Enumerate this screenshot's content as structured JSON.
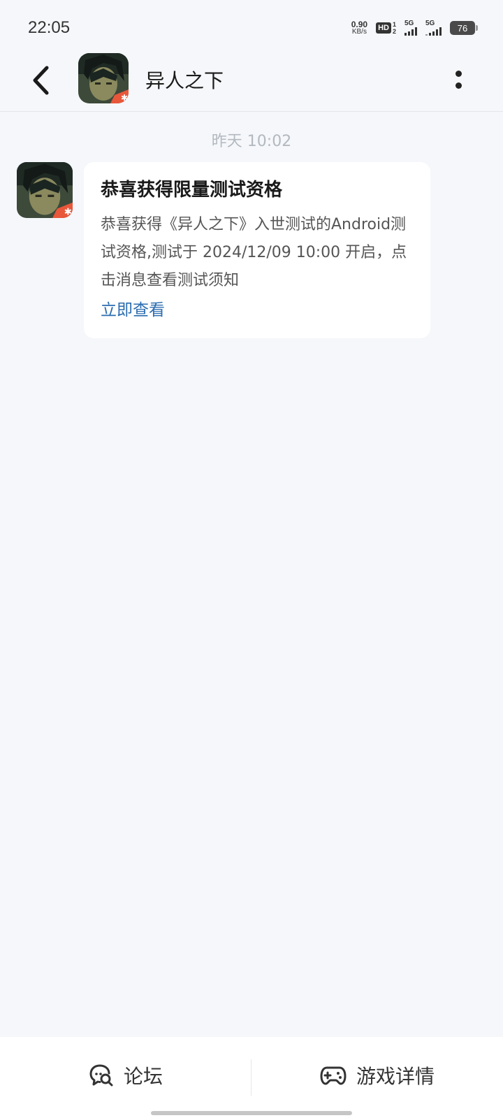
{
  "status_bar": {
    "time": "22:05",
    "net_speed_value": "0.90",
    "net_speed_unit": "KB/s",
    "hd_label": "HD",
    "hd_sim_top": "1",
    "hd_sim_bottom": "2",
    "signal1_label": "5G",
    "signal2_label": "5G",
    "battery_level": "76"
  },
  "header": {
    "title": "异人之下",
    "back_icon": "chevron-left-icon",
    "more_icon": "more-vertical-icon"
  },
  "chat": {
    "timestamp": "昨天  10:02",
    "message": {
      "title": "恭喜获得限量测试资格",
      "body": "恭喜获得《异人之下》入世测试的Android测试资格,测试于 2024/12/09 10:00 开启，点击消息查看测试须知",
      "link_label": "立即查看"
    }
  },
  "bottom_bar": {
    "forum_label": "论坛",
    "forum_icon": "chat-search-icon",
    "game_details_label": "游戏详情",
    "game_details_icon": "gamepad-icon"
  },
  "colors": {
    "background": "#f5f7fa",
    "link": "#2b6cb0",
    "timestamp": "#b4b9c0"
  }
}
